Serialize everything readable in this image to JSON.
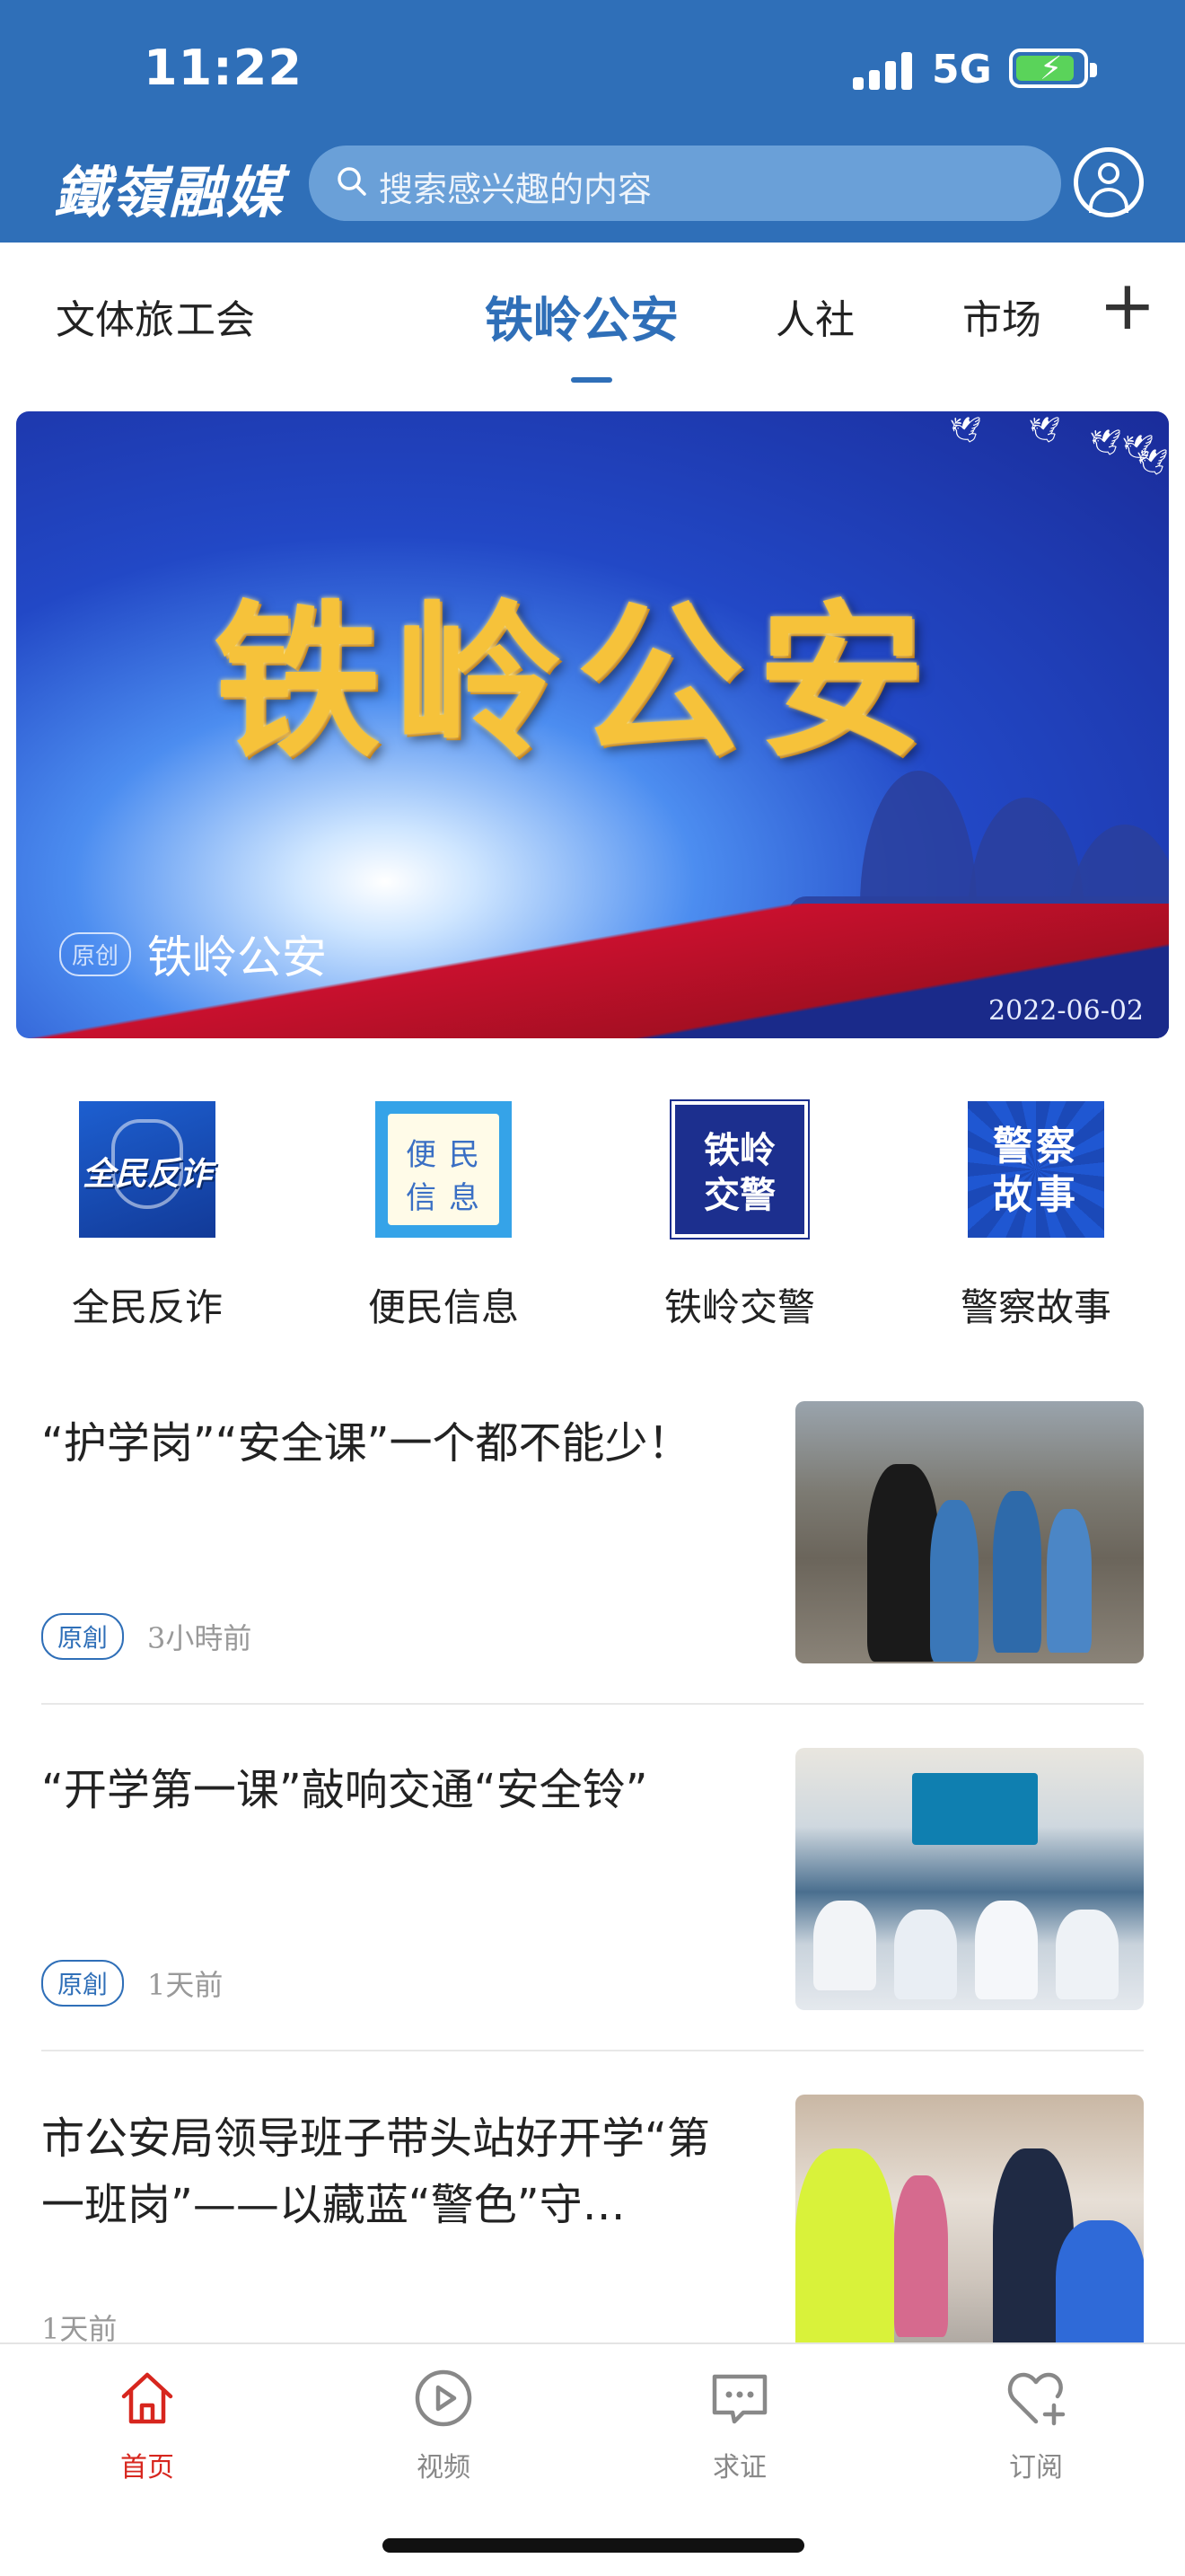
{
  "status_bar": {
    "time": "11:22",
    "network": "5G"
  },
  "header": {
    "logo": "鐵嶺融媒",
    "search_placeholder": "搜索感兴趣的内容"
  },
  "tabs": {
    "items": [
      "文体旅",
      "工会",
      "铁岭公安",
      "人社",
      "市场"
    ],
    "active_index": 2
  },
  "banner": {
    "title": "铁岭公安",
    "badge": "原创",
    "caption": "铁岭公安",
    "date": "2022-06-02"
  },
  "shortcuts": [
    {
      "label": "全民反诈",
      "icon_text": "全民反诈",
      "icon": "anti-fraud-icon"
    },
    {
      "label": "便民信息",
      "icon_text_1": "便",
      "icon_text_2": "民",
      "icon_text_3": "信",
      "icon_text_4": "息",
      "icon": "convenience-info-icon"
    },
    {
      "label": "铁岭交警",
      "icon_text": "铁岭\n交警",
      "icon_line1": "铁岭",
      "icon_line2": "交警",
      "icon": "traffic-police-icon"
    },
    {
      "label": "警察故事",
      "icon_line1": "警察",
      "icon_line2": "故事",
      "icon": "police-story-icon"
    }
  ],
  "news": [
    {
      "title": "“护学岗”“安全课”一个都不能少！",
      "badge": "原創",
      "time": "3小時前"
    },
    {
      "title": "“开学第一课”敲响交通“安全铃”",
      "badge": "原創",
      "time": "1天前"
    },
    {
      "title": "市公安局领导班子带头站好开学“第一班岗”——以藏蓝“警色”守…",
      "badge": "",
      "time": "1天前"
    }
  ],
  "tabbar": {
    "items": [
      {
        "label": "首页",
        "icon": "home-icon",
        "active": true
      },
      {
        "label": "视频",
        "icon": "play-icon",
        "active": false
      },
      {
        "label": "求证",
        "icon": "message-icon",
        "active": false
      },
      {
        "label": "订阅",
        "icon": "heart-plus-icon",
        "active": false
      }
    ]
  },
  "colors": {
    "brand_blue": "#2f6fb8",
    "active_red": "#d7261e"
  }
}
